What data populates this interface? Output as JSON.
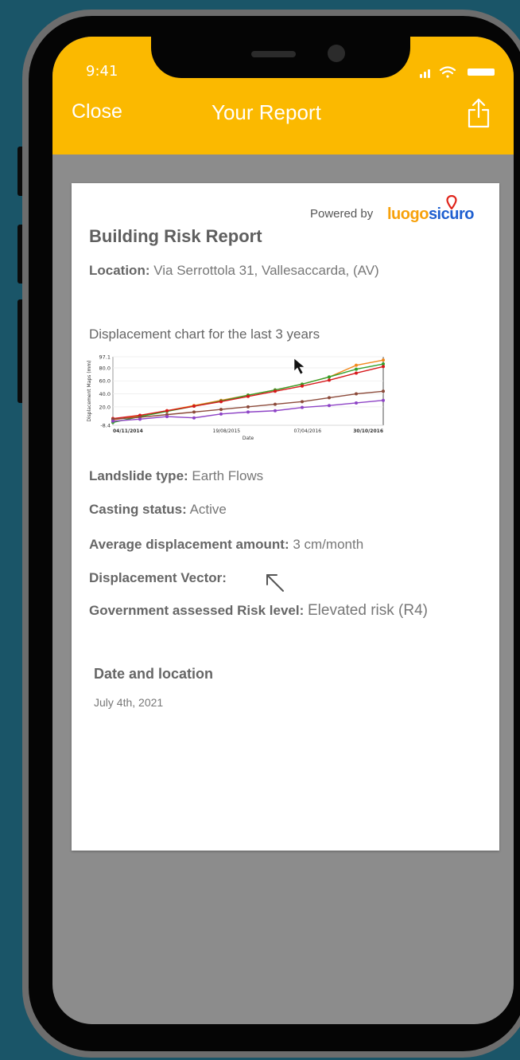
{
  "status_bar": {
    "time": "9:41"
  },
  "appbar": {
    "close_label": "Close",
    "title": "Your Report",
    "share_icon": "share-icon"
  },
  "report": {
    "powered_by": "Powered by",
    "logo_part1": "luogo",
    "logo_part2": "sicuro",
    "title": "Building Risk Report",
    "location_label": "Location:",
    "location_value": "Via Serrottola 31, Vallesaccarda, (AV)",
    "chart_heading": "Displacement chart for the last 3 years",
    "landslide_label": "Landslide type:",
    "landslide_value": "Earth Flows",
    "casting_label": "Casting status:",
    "casting_value": "Active",
    "avg_label": "Average displacement amount:",
    "avg_value": "3 cm/month",
    "vector_label": "Displacement Vector:",
    "vector_icon": "arrow-up-left-icon",
    "risk_label": "Government assessed Risk level:",
    "risk_value": "Elevated risk (R4)",
    "date_heading": "Date and location",
    "date_value": "July 4th, 2021"
  },
  "colors": {
    "accent": "#fbb900",
    "background": "#1a5568",
    "screen": "#8c8c8c",
    "logo_orange": "#f7a10b",
    "logo_blue": "#1e5fd0"
  },
  "chart_data": {
    "type": "line",
    "ylabel": "Displacement Maps (mm)",
    "xlabel": "Date",
    "y_ticks": [
      "97.1",
      "80.0",
      "60.0",
      "40.0",
      "20.0",
      "-8.4"
    ],
    "x_ticks": [
      "04/11/2014",
      "19/08/2015",
      "07/04/2016",
      "30/10/2016"
    ],
    "ylim": [
      -8.4,
      97.1
    ],
    "x": [
      0,
      0.1,
      0.2,
      0.3,
      0.4,
      0.5,
      0.6,
      0.7,
      0.8,
      0.9,
      1.0
    ],
    "series": [
      {
        "color": "#f2891c",
        "values": [
          0,
          6,
          14,
          22,
          30,
          38,
          46,
          55,
          66,
          84,
          92
        ]
      },
      {
        "color": "#33a02c",
        "values": [
          -4,
          5,
          13,
          21,
          29,
          38,
          46,
          55,
          66,
          78,
          86
        ]
      },
      {
        "color": "#d7191c",
        "values": [
          2,
          7,
          14,
          21,
          28,
          36,
          44,
          52,
          61,
          72,
          82
        ]
      },
      {
        "color": "#8c4a3a",
        "values": [
          1,
          4,
          8,
          12,
          16,
          20,
          24,
          28,
          34,
          40,
          44
        ]
      },
      {
        "color": "#8e44c6",
        "values": [
          -2,
          1,
          5,
          3,
          9,
          12,
          14,
          19,
          22,
          26,
          30
        ]
      }
    ]
  }
}
